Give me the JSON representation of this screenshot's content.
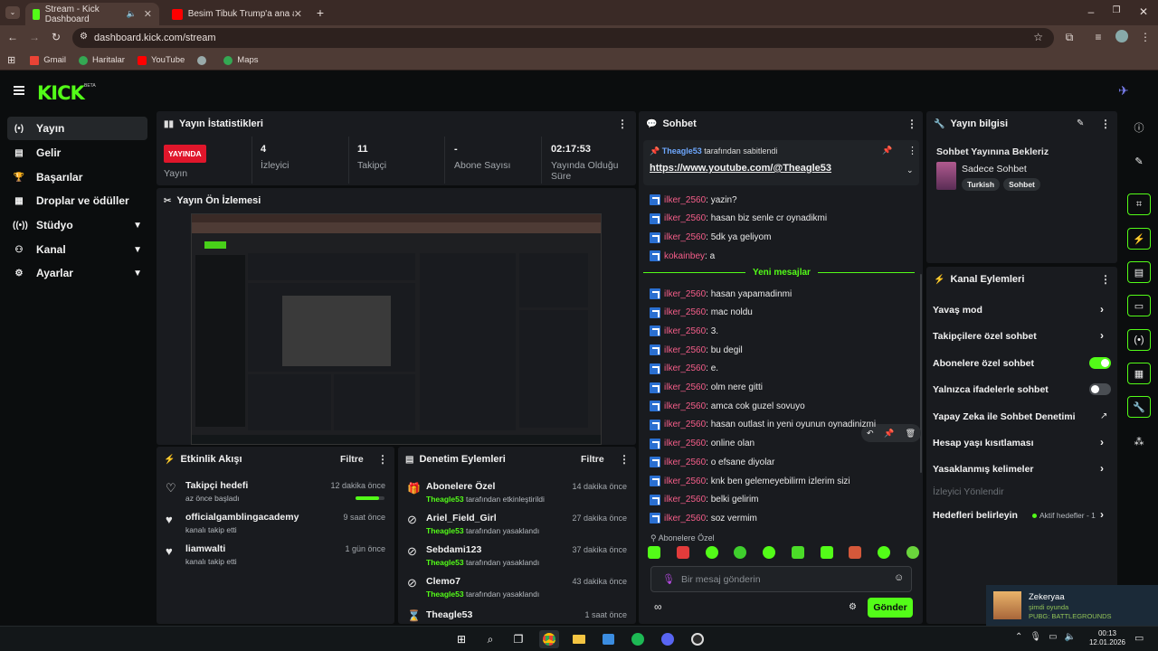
{
  "browser": {
    "tabs": [
      {
        "title": "Stream - Kick Dashboard",
        "active": true
      },
      {
        "title": "Besim Tibuk Trump'a ana avrat",
        "active": false
      }
    ],
    "url": "dashboard.kick.com/stream",
    "bookmarks": [
      "Gmail",
      "Haritalar",
      "YouTube",
      "Maps"
    ]
  },
  "kick": {
    "logo": "KICK",
    "beta": "BETA"
  },
  "sidebar": {
    "items": [
      {
        "label": "Yayın",
        "icon": "broadcast-icon"
      },
      {
        "label": "Gelir",
        "icon": "money-icon"
      },
      {
        "label": "Başarılar",
        "icon": "trophy-icon"
      },
      {
        "label": "Droplar ve ödüller",
        "icon": "gift-icon"
      },
      {
        "label": "Stüdyo",
        "icon": "studio-icon"
      },
      {
        "label": "Kanal",
        "icon": "channel-icon"
      },
      {
        "label": "Ayarlar",
        "icon": "gear-icon"
      }
    ]
  },
  "stats": {
    "title": "Yayın İstatistikleri",
    "live_badge": "YAYINDA",
    "items": [
      {
        "value": "",
        "label": "Yayın"
      },
      {
        "value": "4",
        "label": "İzleyici"
      },
      {
        "value": "11",
        "label": "Takipçi"
      },
      {
        "value": "-",
        "label": "Abone Sayısı"
      },
      {
        "value": "02:17:53",
        "label": "Yayında Olduğu Süre"
      }
    ]
  },
  "preview": {
    "title": "Yayın Ön İzlemesi"
  },
  "activity": {
    "title": "Etkinlik Akışı",
    "filter": "Filtre",
    "items": [
      {
        "title": "Takipçi hedefi",
        "sub": "az önce başladı",
        "time": "12 dakika önce",
        "progress": 0.8
      },
      {
        "title": "officialgamblingacademy",
        "sub": "kanalı takip etti",
        "time": "9 saat önce"
      },
      {
        "title": "liamwalti",
        "sub": "kanalı takip etti",
        "time": "1 gün önce"
      }
    ]
  },
  "moderation": {
    "title": "Denetim Eylemleri",
    "filter": "Filtre",
    "items": [
      {
        "title": "Abonelere Özel",
        "user": "Theagle53",
        "action": "tarafından etkinleştirildi",
        "time": "14 dakika önce"
      },
      {
        "title": "Ariel_Field_Girl",
        "user": "Theagle53",
        "action": "tarafından yasaklandı",
        "time": "27 dakika önce"
      },
      {
        "title": "Sebdami123",
        "user": "Theagle53",
        "action": "tarafından yasaklandı",
        "time": "37 dakika önce"
      },
      {
        "title": "Clemo7",
        "user": "Theagle53",
        "action": "tarafından yasaklandı",
        "time": "43 dakika önce"
      },
      {
        "title": "Theagle53",
        "time": "1 saat önce"
      }
    ]
  },
  "chat": {
    "title": "Sohbet",
    "pinned_user": "Theagle53",
    "pinned_by": "tarafından sabitlendi",
    "pinned_link": "https://www.youtube.com/@Theagle53",
    "messages_before": [
      {
        "user": "ilker_2560",
        "text": ": yazin?"
      },
      {
        "user": "ilker_2560",
        "text": ": hasan biz senle cr oynadikmi"
      },
      {
        "user": "ilker_2560",
        "text": ": 5dk ya geliyom"
      },
      {
        "user": "kokainbey",
        "text": ": a"
      }
    ],
    "new_messages": "Yeni mesajlar",
    "messages_after": [
      {
        "user": "ilker_2560",
        "text": ": hasan yapamadinmi"
      },
      {
        "user": "ilker_2560",
        "text": ": mac noldu"
      },
      {
        "user": "ilker_2560",
        "text": ": 3."
      },
      {
        "user": "ilker_2560",
        "text": ": bu degil"
      },
      {
        "user": "ilker_2560",
        "text": ": e."
      },
      {
        "user": "ilker_2560",
        "text": ": olm nere gitti"
      },
      {
        "user": "ilker_2560",
        "text": ": amca cok guzel sovuyo"
      },
      {
        "user": "ilker_2560",
        "text": ": hasan outlast in yeni oyunun oynadinizmi"
      },
      {
        "user": "ilker_2560",
        "text": ": online olan"
      },
      {
        "user": "ilker_2560",
        "text": ": o efsane diyolar"
      },
      {
        "user": "ilker_2560",
        "text": ": knk ben gelemeyebilirm izlerim sizi"
      },
      {
        "user": "ilker_2560",
        "text": ": belki gelirim"
      },
      {
        "user": "ilker_2560",
        "text": ": soz vermim"
      }
    ],
    "mode_label": "Abonelere Özel",
    "input_placeholder": "Bir mesaj gönderin",
    "send": "Gönder"
  },
  "stream_info": {
    "title": "Yayın bilgisi",
    "stream_title": "Sohbet Yayınına Bekleriz",
    "category": "Sadece Sohbet",
    "tags": [
      "Turkish",
      "Sohbet"
    ]
  },
  "channel_actions": {
    "title": "Kanal Eylemleri",
    "items": [
      {
        "label": "Yavaş mod",
        "type": "chevron"
      },
      {
        "label": "Takipçilere özel sohbet",
        "type": "chevron"
      },
      {
        "label": "Abonelere özel sohbet",
        "type": "toggle",
        "on": true
      },
      {
        "label": "Yalnızca ifadelerle sohbet",
        "type": "toggle",
        "on": false
      },
      {
        "label": "Yapay Zeka ile Sohbet Denetimi",
        "type": "external"
      },
      {
        "label": "Hesap yaşı kısıtlaması",
        "type": "chevron"
      },
      {
        "label": "Yasaklanmış kelimeler",
        "type": "chevron"
      },
      {
        "label": "İzleyici Yönlendir",
        "type": "disabled"
      },
      {
        "label": "Hedefleri belirleyin",
        "type": "chevron",
        "extra": "Aktif hedefler - 1"
      }
    ]
  },
  "notification": {
    "name": "Zekeryaa",
    "status": "şimdi oyunda",
    "game": "PUBG: BATTLEGROUNDS"
  },
  "taskbar": {
    "time": "00:13",
    "date": "12.01.2026"
  },
  "colors": {
    "accent": "#53fc18",
    "live": "#e0162b",
    "username": "#f65e8a"
  }
}
